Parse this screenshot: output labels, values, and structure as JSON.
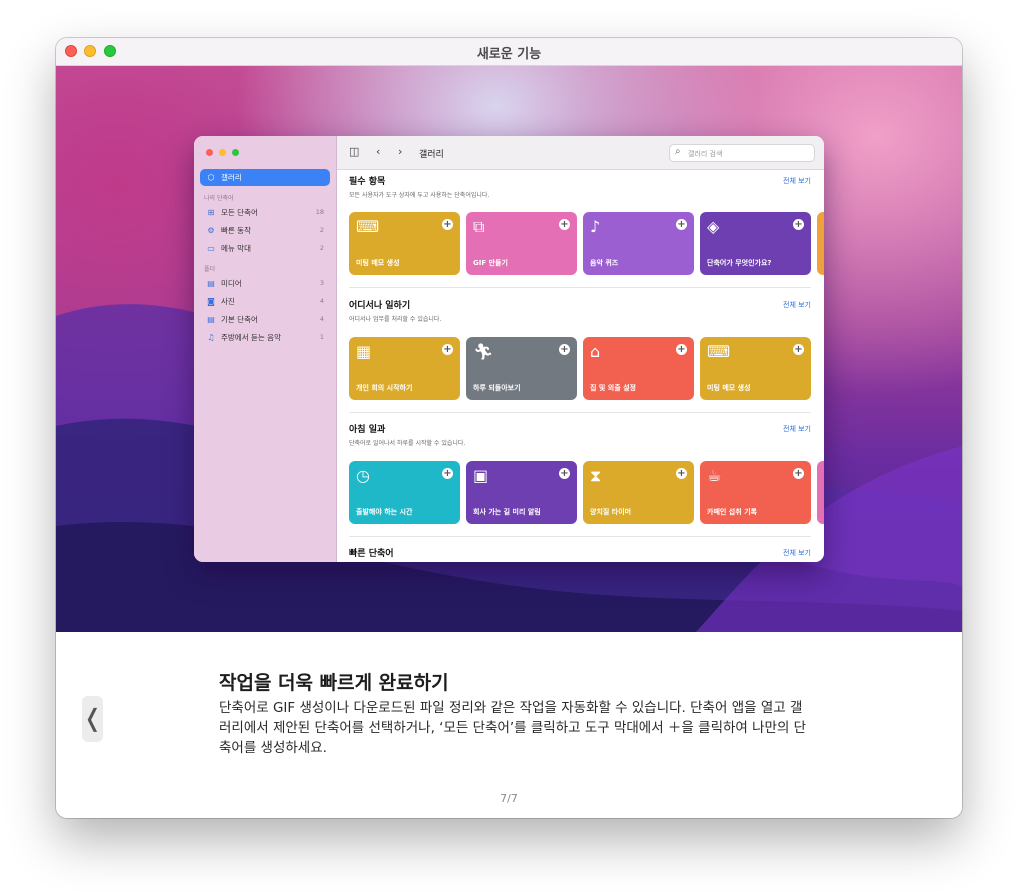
{
  "window": {
    "title": "새로운 기능"
  },
  "inner_app": {
    "sidebar": {
      "selected": "갤러리",
      "section_my": "나의 단축어",
      "my_items": [
        {
          "label": "모든 단축어",
          "count": "18"
        },
        {
          "label": "빠른 동작",
          "count": "2"
        },
        {
          "label": "메뉴 막대",
          "count": "2"
        }
      ],
      "section_folder": "폴더",
      "folder_items": [
        {
          "label": "미디어",
          "count": "3"
        },
        {
          "label": "사진",
          "count": "4"
        },
        {
          "label": "기본 단축어",
          "count": "4"
        },
        {
          "label": "주방에서 듣는 음악",
          "count": "1"
        }
      ]
    },
    "toolbar": {
      "title": "갤러리",
      "search_placeholder": "갤러리 검색"
    },
    "see_all": "전체 보기",
    "sections": [
      {
        "title": "필수 항목",
        "subtitle": "모든 사용자가 도구 상자에 두고 사용하는 단축어입니다.",
        "cards": [
          {
            "label": "미팅 메모 생성",
            "icon": "keyboard-icon",
            "color": "#dcaa2a"
          },
          {
            "label": "GIF 만들기",
            "icon": "photos-icon",
            "color": "#e46fb4"
          },
          {
            "label": "음악 퀴즈",
            "icon": "music-list-icon",
            "color": "#9c5fd2"
          },
          {
            "label": "단축어가 무엇인가요?",
            "icon": "layers-icon",
            "color": "#6e3fb0"
          }
        ]
      },
      {
        "title": "어디서나 일하기",
        "subtitle": "어디서나 업무를 처리할 수 있습니다.",
        "cards": [
          {
            "label": "개인 회의 시작하기",
            "icon": "calendar-icon",
            "color": "#dcaa2a"
          },
          {
            "label": "하루 되돌아보기",
            "icon": "running-icon",
            "color": "#737980"
          },
          {
            "label": "집 및 외출 설정",
            "icon": "home-icon",
            "color": "#f2604f"
          },
          {
            "label": "미팅 메모 생성",
            "icon": "keyboard-icon",
            "color": "#dcaa2a"
          }
        ]
      },
      {
        "title": "아침 일과",
        "subtitle": "단축어로 일어나서 하루를 시작할 수 있습니다.",
        "cards": [
          {
            "label": "출발해야 하는 시간",
            "icon": "clock-icon",
            "color": "#1fb8c9"
          },
          {
            "label": "회사 가는 길 미리 알림",
            "icon": "briefcase-icon",
            "color": "#6e3fb0"
          },
          {
            "label": "양치질 타이머",
            "icon": "hourglass-icon",
            "color": "#dcaa2a"
          },
          {
            "label": "카페인 섭취 기록",
            "icon": "coffee-icon",
            "color": "#f2604f"
          }
        ]
      },
      {
        "title": "빠른 단축어"
      }
    ]
  },
  "headline": "작업을 더욱 빠르게 완료하기",
  "body": "단축어로 GIF 생성이나 다운로드된 파일 정리와 같은 작업을 자동화할 수 있습니다. 단축어 앱을 열고 갤러리에서 제안된 단축어를 선택하거나, ‘모든 단축어’를 클릭하고 도구 막대에서 ＋을 클릭하여 나만의 단축어를 생성하세요.",
  "back_button": "❬",
  "page_indicator": "7/7"
}
